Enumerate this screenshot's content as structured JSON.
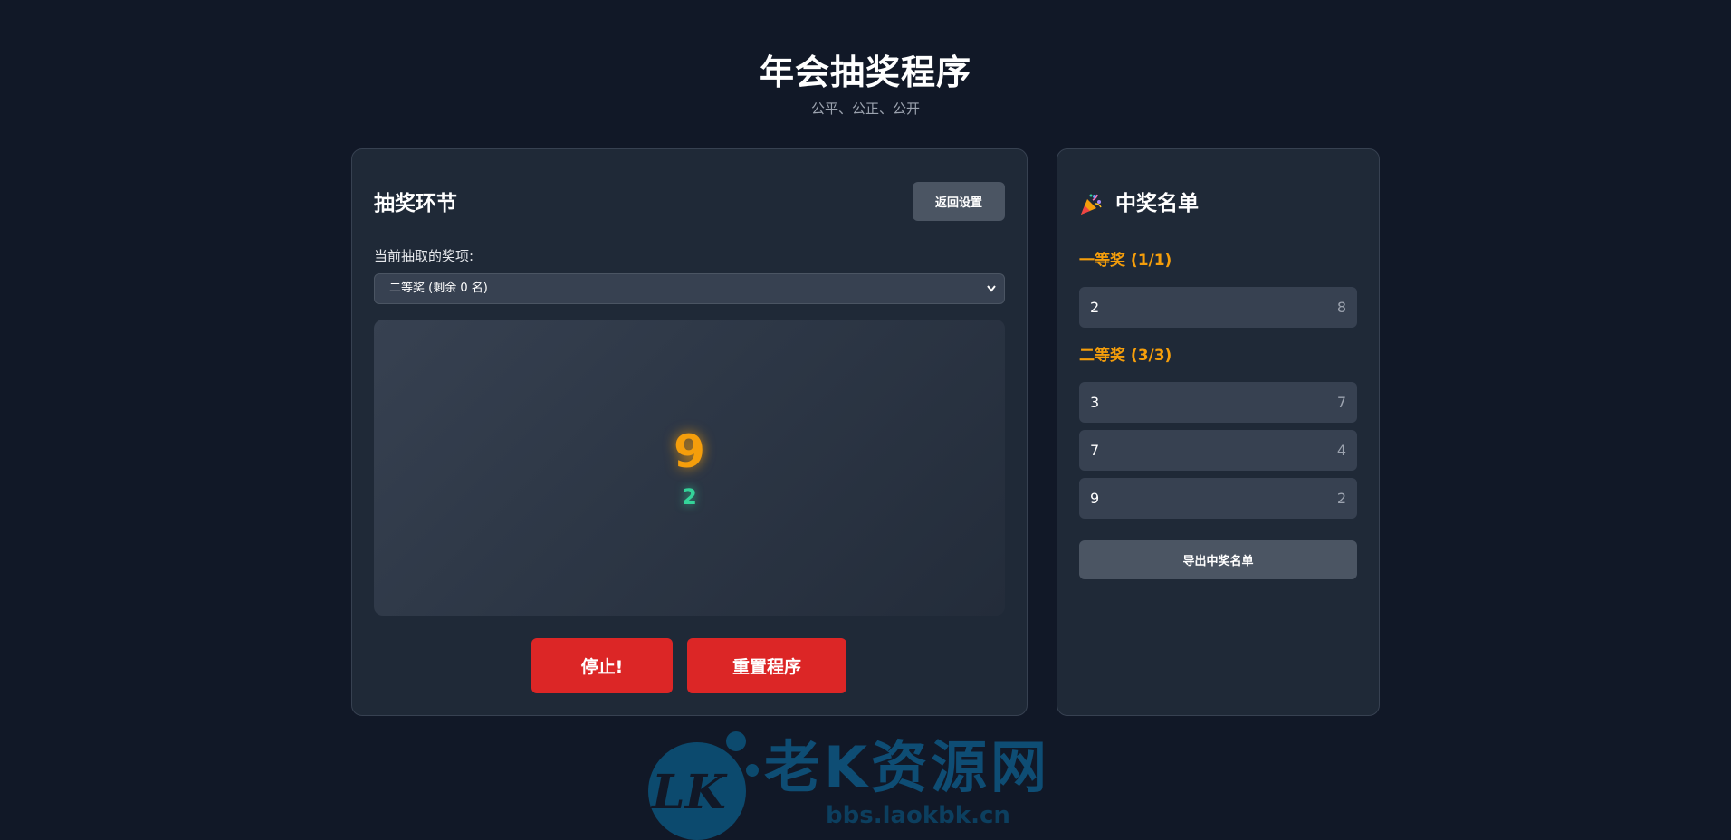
{
  "header": {
    "title": "年会抽奖程序",
    "subtitle": "公平、公正、公开"
  },
  "draw": {
    "title": "抽奖环节",
    "back_label": "返回设置",
    "prize_label": "当前抽取的奖项:",
    "prize_selected": "二等奖 (剩余 0 名)",
    "current_number": "9",
    "current_sub": "2",
    "stop_label": "停止!",
    "reset_label": "重置程序"
  },
  "winners": {
    "title": "中奖名单",
    "icon": "party-popper-icon",
    "groups": [
      {
        "title": "一等奖 (1/1)",
        "items": [
          {
            "name": "2",
            "no": "8"
          }
        ]
      },
      {
        "title": "二等奖 (3/3)",
        "items": [
          {
            "name": "3",
            "no": "7"
          },
          {
            "name": "7",
            "no": "4"
          },
          {
            "name": "9",
            "no": "2"
          }
        ]
      }
    ],
    "export_label": "导出中奖名单"
  },
  "watermark": {
    "logo": "LK",
    "text": "老K资源网",
    "url": "bbs.laokbk.cn"
  },
  "colors": {
    "background": "#111827",
    "panel": "#1f2937",
    "accent": "#f59e0b",
    "danger": "#dc2626",
    "success": "#34d399"
  }
}
